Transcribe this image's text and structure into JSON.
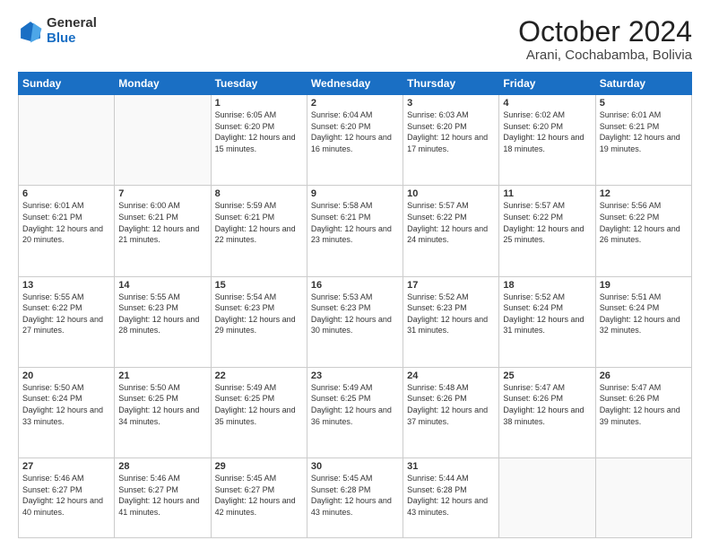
{
  "logo": {
    "line1": "General",
    "line2": "Blue"
  },
  "title": "October 2024",
  "subtitle": "Arani, Cochabamba, Bolivia",
  "days_of_week": [
    "Sunday",
    "Monday",
    "Tuesday",
    "Wednesday",
    "Thursday",
    "Friday",
    "Saturday"
  ],
  "weeks": [
    [
      {
        "day": "",
        "info": ""
      },
      {
        "day": "",
        "info": ""
      },
      {
        "day": "1",
        "info": "Sunrise: 6:05 AM\nSunset: 6:20 PM\nDaylight: 12 hours and 15 minutes."
      },
      {
        "day": "2",
        "info": "Sunrise: 6:04 AM\nSunset: 6:20 PM\nDaylight: 12 hours and 16 minutes."
      },
      {
        "day": "3",
        "info": "Sunrise: 6:03 AM\nSunset: 6:20 PM\nDaylight: 12 hours and 17 minutes."
      },
      {
        "day": "4",
        "info": "Sunrise: 6:02 AM\nSunset: 6:20 PM\nDaylight: 12 hours and 18 minutes."
      },
      {
        "day": "5",
        "info": "Sunrise: 6:01 AM\nSunset: 6:21 PM\nDaylight: 12 hours and 19 minutes."
      }
    ],
    [
      {
        "day": "6",
        "info": "Sunrise: 6:01 AM\nSunset: 6:21 PM\nDaylight: 12 hours and 20 minutes."
      },
      {
        "day": "7",
        "info": "Sunrise: 6:00 AM\nSunset: 6:21 PM\nDaylight: 12 hours and 21 minutes."
      },
      {
        "day": "8",
        "info": "Sunrise: 5:59 AM\nSunset: 6:21 PM\nDaylight: 12 hours and 22 minutes."
      },
      {
        "day": "9",
        "info": "Sunrise: 5:58 AM\nSunset: 6:21 PM\nDaylight: 12 hours and 23 minutes."
      },
      {
        "day": "10",
        "info": "Sunrise: 5:57 AM\nSunset: 6:22 PM\nDaylight: 12 hours and 24 minutes."
      },
      {
        "day": "11",
        "info": "Sunrise: 5:57 AM\nSunset: 6:22 PM\nDaylight: 12 hours and 25 minutes."
      },
      {
        "day": "12",
        "info": "Sunrise: 5:56 AM\nSunset: 6:22 PM\nDaylight: 12 hours and 26 minutes."
      }
    ],
    [
      {
        "day": "13",
        "info": "Sunrise: 5:55 AM\nSunset: 6:22 PM\nDaylight: 12 hours and 27 minutes."
      },
      {
        "day": "14",
        "info": "Sunrise: 5:55 AM\nSunset: 6:23 PM\nDaylight: 12 hours and 28 minutes."
      },
      {
        "day": "15",
        "info": "Sunrise: 5:54 AM\nSunset: 6:23 PM\nDaylight: 12 hours and 29 minutes."
      },
      {
        "day": "16",
        "info": "Sunrise: 5:53 AM\nSunset: 6:23 PM\nDaylight: 12 hours and 30 minutes."
      },
      {
        "day": "17",
        "info": "Sunrise: 5:52 AM\nSunset: 6:23 PM\nDaylight: 12 hours and 31 minutes."
      },
      {
        "day": "18",
        "info": "Sunrise: 5:52 AM\nSunset: 6:24 PM\nDaylight: 12 hours and 31 minutes."
      },
      {
        "day": "19",
        "info": "Sunrise: 5:51 AM\nSunset: 6:24 PM\nDaylight: 12 hours and 32 minutes."
      }
    ],
    [
      {
        "day": "20",
        "info": "Sunrise: 5:50 AM\nSunset: 6:24 PM\nDaylight: 12 hours and 33 minutes."
      },
      {
        "day": "21",
        "info": "Sunrise: 5:50 AM\nSunset: 6:25 PM\nDaylight: 12 hours and 34 minutes."
      },
      {
        "day": "22",
        "info": "Sunrise: 5:49 AM\nSunset: 6:25 PM\nDaylight: 12 hours and 35 minutes."
      },
      {
        "day": "23",
        "info": "Sunrise: 5:49 AM\nSunset: 6:25 PM\nDaylight: 12 hours and 36 minutes."
      },
      {
        "day": "24",
        "info": "Sunrise: 5:48 AM\nSunset: 6:26 PM\nDaylight: 12 hours and 37 minutes."
      },
      {
        "day": "25",
        "info": "Sunrise: 5:47 AM\nSunset: 6:26 PM\nDaylight: 12 hours and 38 minutes."
      },
      {
        "day": "26",
        "info": "Sunrise: 5:47 AM\nSunset: 6:26 PM\nDaylight: 12 hours and 39 minutes."
      }
    ],
    [
      {
        "day": "27",
        "info": "Sunrise: 5:46 AM\nSunset: 6:27 PM\nDaylight: 12 hours and 40 minutes."
      },
      {
        "day": "28",
        "info": "Sunrise: 5:46 AM\nSunset: 6:27 PM\nDaylight: 12 hours and 41 minutes."
      },
      {
        "day": "29",
        "info": "Sunrise: 5:45 AM\nSunset: 6:27 PM\nDaylight: 12 hours and 42 minutes."
      },
      {
        "day": "30",
        "info": "Sunrise: 5:45 AM\nSunset: 6:28 PM\nDaylight: 12 hours and 43 minutes."
      },
      {
        "day": "31",
        "info": "Sunrise: 5:44 AM\nSunset: 6:28 PM\nDaylight: 12 hours and 43 minutes."
      },
      {
        "day": "",
        "info": ""
      },
      {
        "day": "",
        "info": ""
      }
    ]
  ]
}
